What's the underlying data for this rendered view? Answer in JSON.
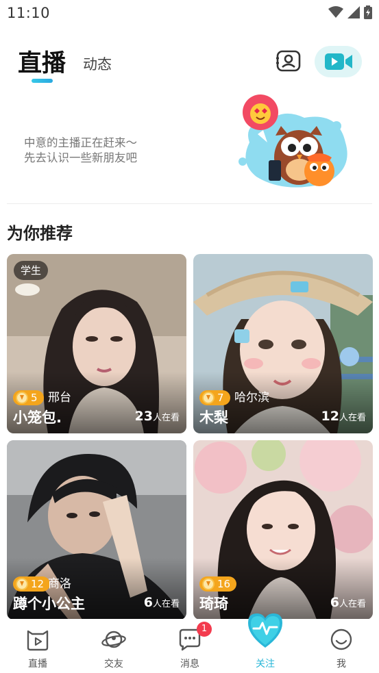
{
  "status_bar": {
    "time": "11:10"
  },
  "header": {
    "tabs": [
      {
        "label": "直播",
        "active": true
      },
      {
        "label": "动态",
        "active": false
      }
    ]
  },
  "banner": {
    "line1": "中意的主播正在赶来～",
    "line2": "先去认识一些新朋友吧"
  },
  "recommend": {
    "title": "为你推荐",
    "cards": [
      {
        "tag": "学生",
        "level": "5",
        "city": "邢台",
        "name": "小笼包.",
        "viewer_count": "23",
        "viewer_suffix": "人在看"
      },
      {
        "tag": "",
        "level": "7",
        "city": "哈尔滨",
        "name": "木梨",
        "viewer_count": "12",
        "viewer_suffix": "人在看"
      },
      {
        "tag": "",
        "level": "12",
        "city": "商洛",
        "name": "蹲个小公主",
        "viewer_count": "6",
        "viewer_suffix": "人在看"
      },
      {
        "tag": "",
        "level": "16",
        "city": "",
        "name": "琦琦",
        "viewer_count": "6",
        "viewer_suffix": "人在看"
      }
    ]
  },
  "bottom_nav": {
    "items": [
      {
        "label": "直播",
        "icon": "tv-cat-icon"
      },
      {
        "label": "交友",
        "icon": "planet-icon"
      },
      {
        "label": "消息",
        "icon": "chat-bubble-icon",
        "badge": "1"
      },
      {
        "label": "关注",
        "icon": "heart-pulse-icon",
        "active": true
      },
      {
        "label": "我",
        "icon": "smile-icon"
      }
    ]
  },
  "colors": {
    "accent": "#2ab7d8",
    "level_badge": "#f4a51c",
    "message_badge": "#f33b4e"
  }
}
